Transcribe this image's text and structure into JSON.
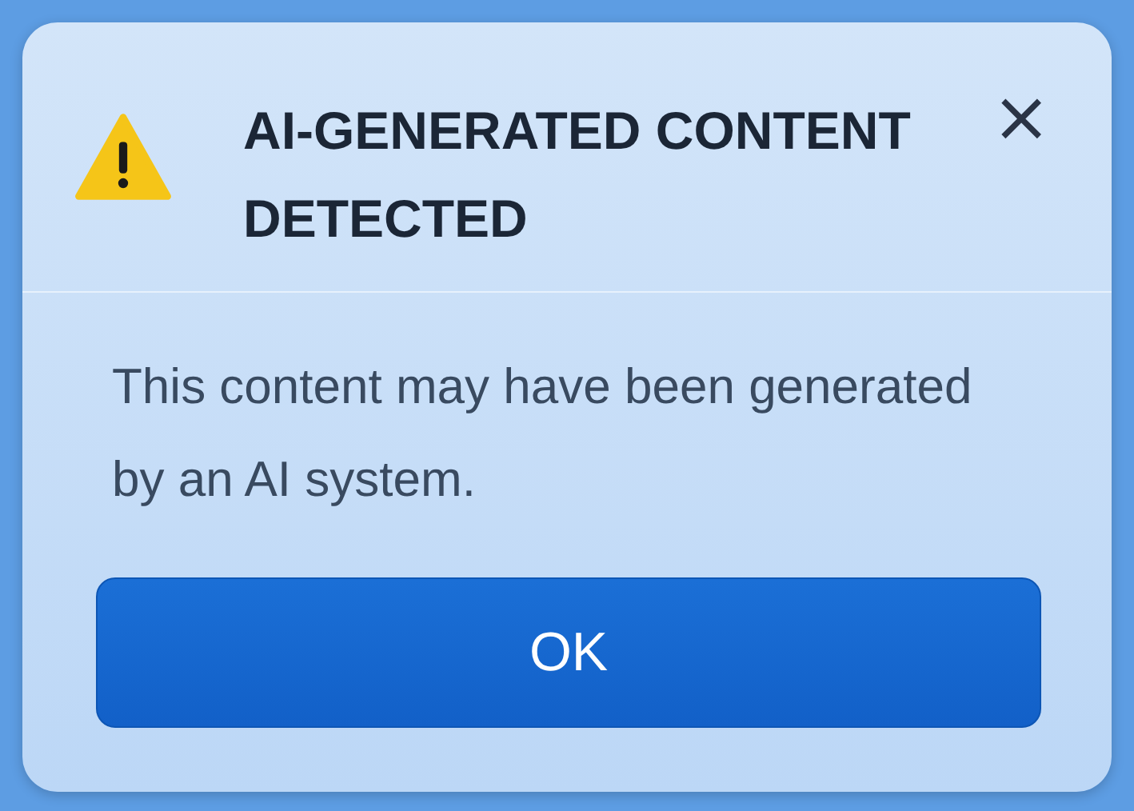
{
  "dialog": {
    "title": "AI-GENERATED CONTENT DETECTED",
    "close": "×",
    "message": "This content may have been generated by an AI system.",
    "buttons": [
      "OK"
    ]
  }
}
